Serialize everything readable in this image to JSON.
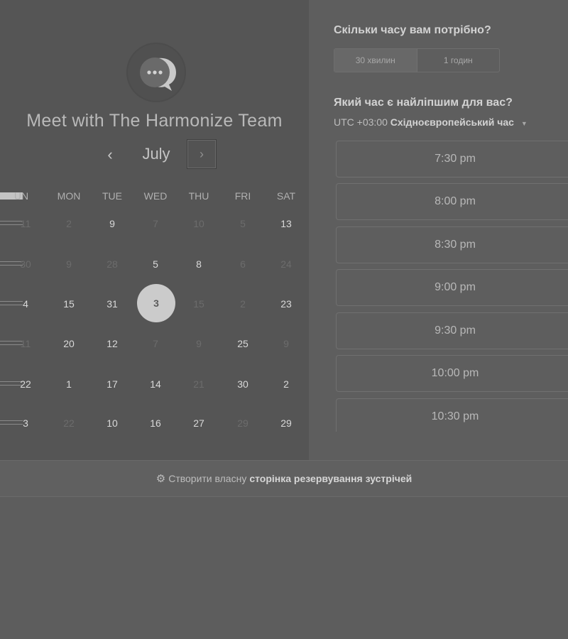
{
  "header": {
    "title": "Meet with The Harmonize Team"
  },
  "calendar": {
    "month": "July",
    "prev_icon": "‹",
    "next_icon": "›",
    "weekdays": [
      "SUN",
      "MON",
      "TUE",
      "WED",
      "THU",
      "FRI",
      "SAT"
    ],
    "weekdays_visible": [
      "UN",
      "MON",
      "TUE",
      "WED",
      "THU",
      "FRI",
      "SAT"
    ],
    "weeks": [
      [
        "11",
        "2",
        "9",
        "7",
        "10",
        "5",
        "13"
      ],
      [
        "30",
        "9",
        "28",
        "5",
        "8",
        "6",
        "24"
      ],
      [
        "4",
        "15",
        "31",
        "3",
        "15",
        "2",
        "23"
      ],
      [
        "11",
        "20",
        "12",
        "7",
        "9",
        "25",
        "9"
      ],
      [
        "22",
        "1",
        "17",
        "14",
        "21",
        "30",
        "2"
      ],
      [
        "3",
        "22",
        "10",
        "16",
        "27",
        "29",
        "29"
      ]
    ],
    "active": [
      [
        false,
        false,
        true,
        false,
        false,
        false,
        true
      ],
      [
        false,
        false,
        false,
        true,
        true,
        false,
        false
      ],
      [
        true,
        true,
        true,
        true,
        false,
        false,
        true
      ],
      [
        false,
        true,
        true,
        false,
        false,
        true,
        false
      ],
      [
        true,
        true,
        true,
        true,
        false,
        true,
        true
      ],
      [
        true,
        false,
        true,
        true,
        true,
        false,
        true
      ]
    ],
    "selected_day": "3"
  },
  "booking": {
    "duration_question": "Скільки часу вам потрібно?",
    "durations": [
      "30 хвилин",
      "1 годин"
    ],
    "selected_duration": "30 хвилин",
    "time_question": "Який час є найліпшим для вас?",
    "timezone_offset": "UTC +03:00",
    "timezone_name": "Східноєвропейський час",
    "slots": [
      "7:30 pm",
      "8:00 pm",
      "8:30 pm",
      "9:00 pm",
      "9:30 pm",
      "10:00 pm",
      "10:30 pm"
    ]
  },
  "footer": {
    "prefix": "Створити власну",
    "link": "сторінка резервування зустрічей"
  },
  "icons": {
    "logo": "chat-bubble-logo-icon",
    "footer": "sprocket-icon",
    "timezone_caret": "caret-down-icon"
  },
  "colors": {
    "overlay_dim": "#5d5d5d",
    "selected_day": "#cbcbcb"
  }
}
